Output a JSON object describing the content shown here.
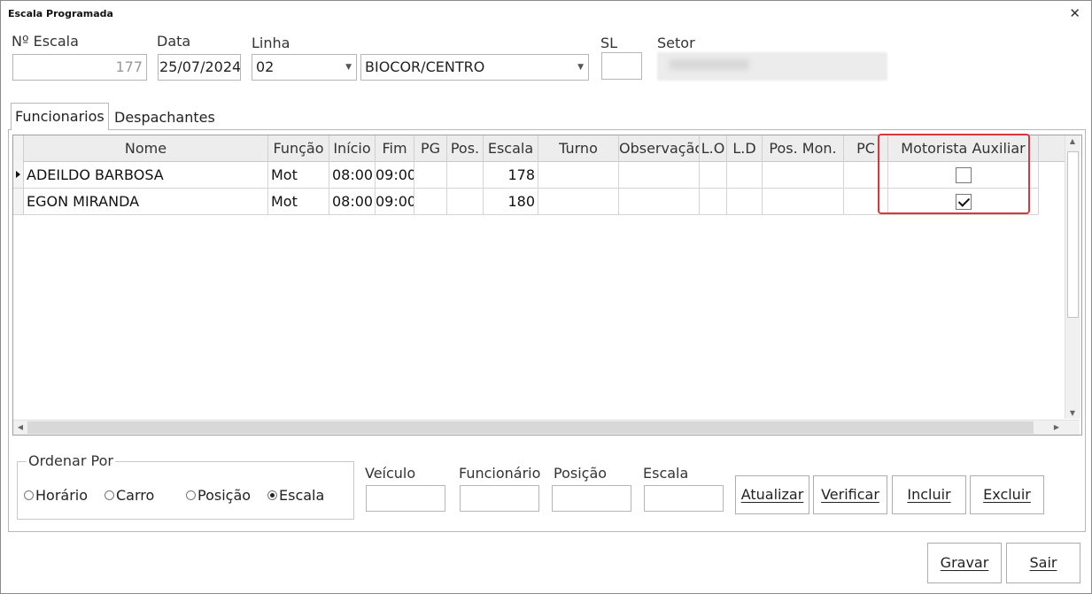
{
  "window": {
    "title": "Escala Programada",
    "close_glyph": "✕"
  },
  "form": {
    "escala_label": "Nº Escala",
    "escala_value": "177",
    "data_label": "Data",
    "data_value": "25/07/2024",
    "linha_label": "Linha",
    "linha_value": "02",
    "linha_desc_value": "BIOCOR/CENTRO",
    "sl_label": "SL",
    "sl_value": "",
    "setor_label": "Setor"
  },
  "tabs": [
    {
      "label": "Funcionarios",
      "active": true
    },
    {
      "label": "Despachantes",
      "active": false
    }
  ],
  "grid": {
    "columns": [
      "Nome",
      "Função",
      "Início",
      "Fim",
      "PG",
      "Pos.",
      "Escala",
      "Turno",
      "Observação",
      "L.O",
      "L.D",
      "Pos. Mon.",
      "PC",
      "Motorista Auxiliar"
    ],
    "rows": [
      {
        "nome": "ADEILDO BARBOSA",
        "funcao": "Mot",
        "inicio": "08:00",
        "fim": "09:00",
        "pg": "",
        "pos": "",
        "escala": "178",
        "turno": "",
        "obs": "",
        "lo": "",
        "ld": "",
        "posmon": "",
        "pc": "",
        "motorista_auxiliar": false,
        "current": true
      },
      {
        "nome": "EGON MIRANDA",
        "funcao": "Mot",
        "inicio": "08:00",
        "fim": "09:00",
        "pg": "",
        "pos": "",
        "escala": "180",
        "turno": "",
        "obs": "",
        "lo": "",
        "ld": "",
        "posmon": "",
        "pc": "",
        "motorista_auxiliar": true,
        "current": false
      }
    ]
  },
  "ordenar": {
    "title": "Ordenar Por",
    "options": [
      {
        "label": "Horário",
        "selected": false
      },
      {
        "label": "Carro",
        "selected": false
      },
      {
        "label": "Posição",
        "selected": false
      },
      {
        "label": "Escala",
        "selected": true
      }
    ]
  },
  "filters": {
    "veiculo_label": "Veículo",
    "funcionario_label": "Funcionário",
    "posicao_label": "Posição",
    "escala_label": "Escala"
  },
  "buttons": {
    "atualizar": "Atualizar",
    "verificar": "Verificar",
    "incluir": "Incluir",
    "excluir": "Excluir",
    "gravar": "Gravar",
    "sair": "Sair"
  },
  "colors": {
    "highlight": "#d9363e",
    "header_bg": "#ededed"
  }
}
